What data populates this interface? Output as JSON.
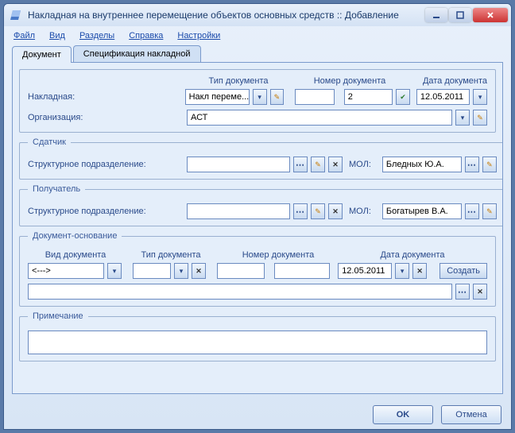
{
  "window": {
    "title": "Накладная на внутреннее перемещение объектов основных средств :: Добавление"
  },
  "menu": {
    "file": "Файл",
    "view": "Вид",
    "sections": "Разделы",
    "help": "Справка",
    "settings": "Настройки"
  },
  "tabs": {
    "document": "Документ",
    "spec": "Спецификация накладной"
  },
  "headers": {
    "doc_type": "Тип документа",
    "doc_number": "Номер документа",
    "doc_date": "Дата документа",
    "doc_kind": "Вид документа"
  },
  "labels": {
    "invoice": "Накладная:",
    "org": "Организация:",
    "struct": "Структурное подразделение:",
    "mol": "МОЛ:"
  },
  "legends": {
    "sender": "Сдатчик",
    "receiver": "Получатель",
    "basis": "Документ-основание",
    "note": "Примечание"
  },
  "values": {
    "doc_type_val": "Накл переме...",
    "doc_number_2": "2",
    "doc_date_val": "12.05.2011",
    "org_val": "АСТ",
    "mol_sender": "Бледных Ю.А.",
    "mol_receiver": "Богатырев В.А.",
    "doc_kind_val": "<--->",
    "basis_date": "12.05.2011"
  },
  "buttons": {
    "create": "Создать",
    "ok": "OK",
    "cancel": "Отмена"
  }
}
